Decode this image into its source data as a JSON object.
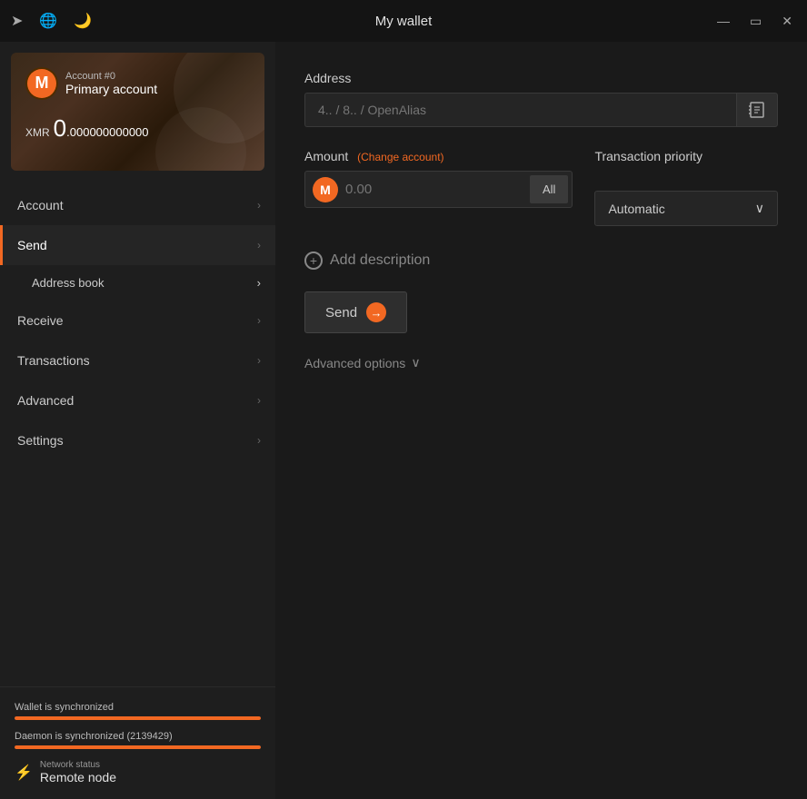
{
  "titlebar": {
    "title": "My wallet",
    "icons": {
      "arrow": "➤",
      "globe": "🌐",
      "moon": "🌙"
    },
    "controls": {
      "minimize": "—",
      "maximize": "▭",
      "close": "✕"
    }
  },
  "account_card": {
    "account_num": "Account #0",
    "account_name": "Primary account",
    "currency": "XMR",
    "amount_integer": "0",
    "amount_decimal": ".000000000000"
  },
  "sidebar": {
    "items": [
      {
        "label": "Account",
        "active": false,
        "sub": []
      },
      {
        "label": "Send",
        "active": true,
        "sub": [
          {
            "label": "Address book"
          }
        ]
      },
      {
        "label": "Receive",
        "active": false,
        "sub": []
      },
      {
        "label": "Transactions",
        "active": false,
        "sub": []
      },
      {
        "label": "Advanced",
        "active": false,
        "sub": []
      },
      {
        "label": "Settings",
        "active": false,
        "sub": []
      }
    ]
  },
  "footer": {
    "wallet_sync_label": "Wallet is synchronized",
    "daemon_sync_label": "Daemon is synchronized (2139429)",
    "network_label": "Network status",
    "network_value": "Remote node"
  },
  "send_form": {
    "address_label": "Address",
    "address_placeholder": "4.. / 8.. / OpenAlias",
    "amount_label": "Amount",
    "change_account_label": "(Change account)",
    "amount_placeholder": "0.00",
    "all_btn_label": "All",
    "priority_label": "Transaction priority",
    "priority_value": "Automatic",
    "add_description_label": "Add description",
    "send_btn_label": "Send",
    "advanced_options_label": "Advanced options"
  }
}
